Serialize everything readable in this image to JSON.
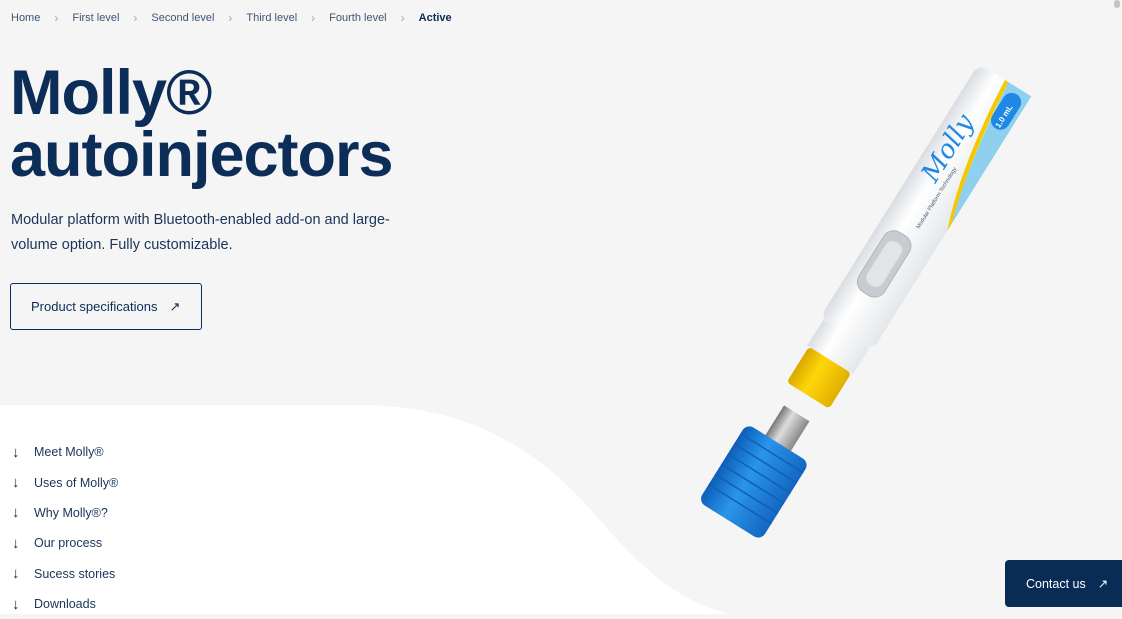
{
  "breadcrumb": [
    "Home",
    "First level",
    "Second level",
    "Third level",
    "Fourth level",
    "Active"
  ],
  "hero": {
    "title_line1": "Molly®",
    "title_line2": "autoinjectors",
    "subtitle": "Modular platform with Bluetooth-enabled add-on and large-volume option. Fully customizable.",
    "cta_label": "Product specifications",
    "cta_icon": "arrow-up-right-icon"
  },
  "anchor_nav": {
    "icon": "arrow-down-icon",
    "items": [
      "Meet Molly®",
      "Uses of Molly®",
      "Why Molly®?",
      "Our process",
      "Sucess stories",
      "Downloads"
    ]
  },
  "product_image": {
    "lettering": [
      "Molly",
      "1.0 mL",
      "Modular Platform Technology"
    ]
  },
  "contact": {
    "label": "Contact us",
    "icon": "arrow-up-right-icon"
  },
  "colors": {
    "navy": "#0c2d57",
    "pen_blue": "#1e88e5",
    "pen_yellow": "#f5c800",
    "light_blue": "#8fd0ef"
  }
}
